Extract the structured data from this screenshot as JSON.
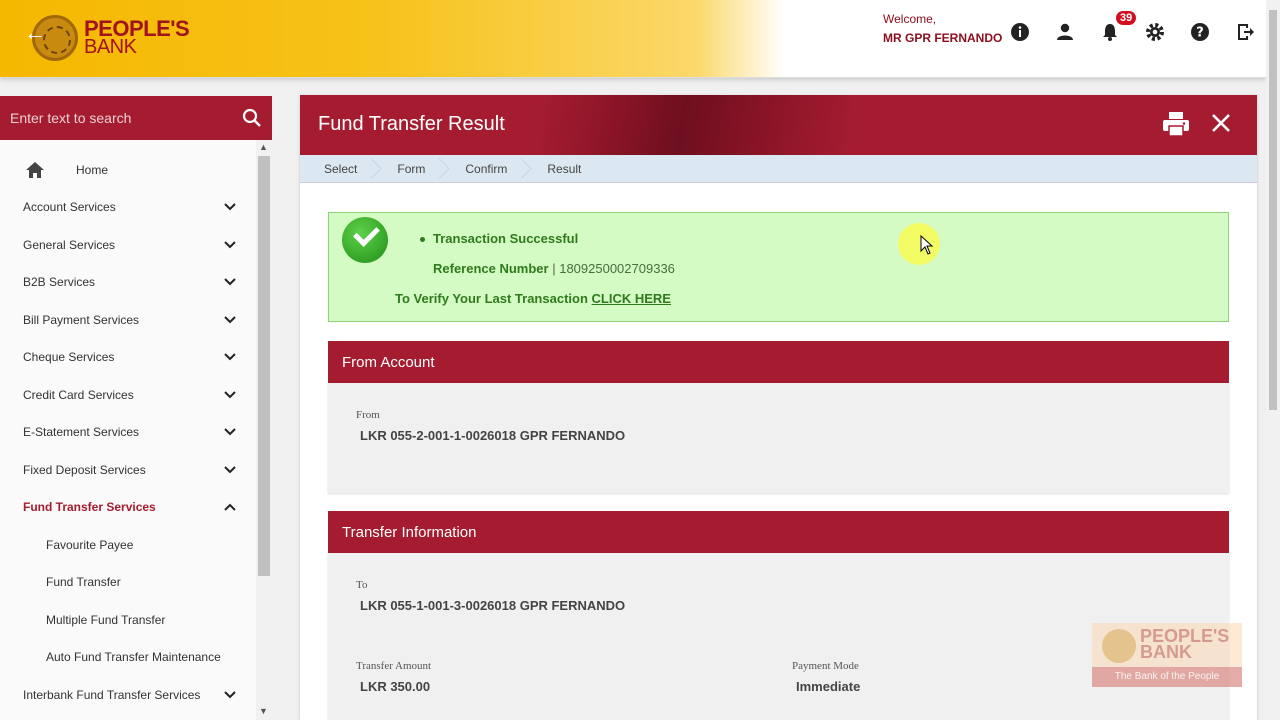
{
  "header": {
    "brand_line1": "PEOPLE'S",
    "brand_line2": "BANK",
    "welcome": "Welcome,",
    "user_name": "MR GPR FERNANDO",
    "notification_count": "39",
    "icons": [
      "info-icon",
      "user-icon",
      "bell-icon",
      "gear-icon",
      "help-icon",
      "logout-icon"
    ]
  },
  "sidebar": {
    "search_placeholder": "Enter text to search",
    "items": [
      {
        "label": "Home"
      },
      {
        "label": "Account Services"
      },
      {
        "label": "General Services"
      },
      {
        "label": "B2B Services"
      },
      {
        "label": "Bill Payment Services"
      },
      {
        "label": "Cheque Services"
      },
      {
        "label": "Credit Card Services"
      },
      {
        "label": "E-Statement Services"
      },
      {
        "label": "Fixed Deposit Services"
      },
      {
        "label": "Fund Transfer Services"
      },
      {
        "label": "Favourite Payee"
      },
      {
        "label": "Fund Transfer"
      },
      {
        "label": "Multiple Fund Transfer"
      },
      {
        "label": "Auto Fund Transfer Maintenance"
      },
      {
        "label": "Interbank Fund Transfer Services"
      }
    ]
  },
  "main": {
    "title": "Fund Transfer Result",
    "breadcrumbs": [
      "Select",
      "Form",
      "Confirm",
      "Result"
    ],
    "result": {
      "status": "Transaction Successful",
      "reference_label": "Reference Number",
      "reference_sep": " | ",
      "reference_value": "1809250002709336",
      "verify_text": "To Verify Your Last Transaction ",
      "verify_link": "CLICK HERE"
    },
    "from_section": {
      "title": "From Account",
      "from_label": "From",
      "from_value": "LKR 055-2-001-1-0026018 GPR FERNANDO"
    },
    "transfer_section": {
      "title": "Transfer Information",
      "to_label": "To",
      "to_value": "LKR 055-1-001-3-0026018 GPR FERNANDO",
      "amount_label": "Transfer Amount",
      "amount_value": "LKR 350.00",
      "mode_label": "Payment Mode",
      "mode_value": "Immediate"
    }
  },
  "watermark": {
    "line1": "PEOPLE'S",
    "line2": "BANK",
    "tagline": "The Bank of the People"
  },
  "colors": {
    "brand_red": "#a51c30",
    "brand_yellow": "#f5b800",
    "success_bg": "#d4fbc4",
    "success_text": "#2f7a1d"
  }
}
